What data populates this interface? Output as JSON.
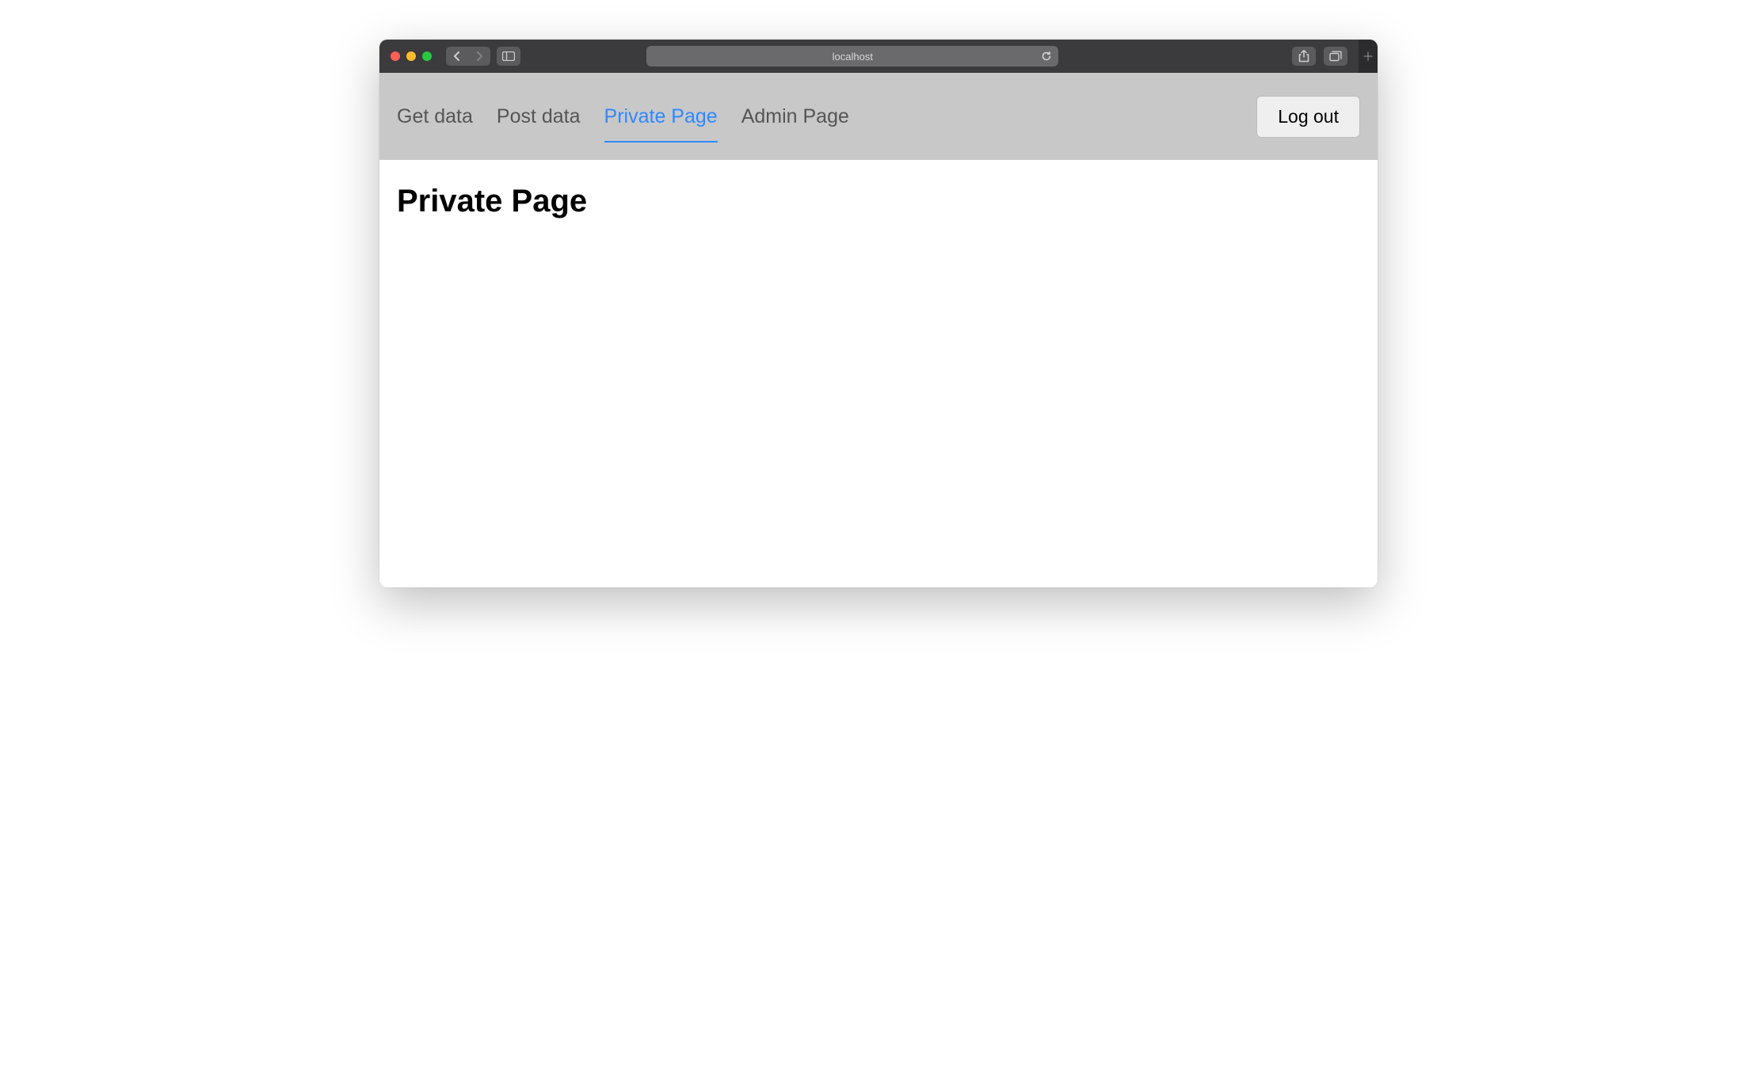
{
  "browser": {
    "address": "localhost"
  },
  "nav": {
    "tabs": [
      {
        "label": "Get data"
      },
      {
        "label": "Post data"
      },
      {
        "label": "Private Page"
      },
      {
        "label": "Admin Page"
      }
    ],
    "active_index": 2,
    "logout_label": "Log out"
  },
  "main": {
    "title": "Private Page"
  }
}
